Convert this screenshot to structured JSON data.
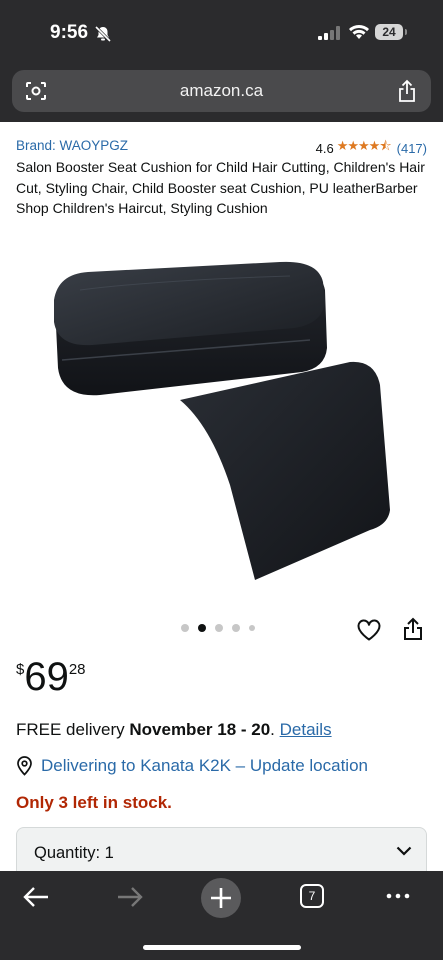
{
  "status_bar": {
    "time": "9:56",
    "battery": "24"
  },
  "browser": {
    "url": "amazon.ca",
    "tab_count": "7"
  },
  "product": {
    "brand": "Brand: WAOYPGZ",
    "rating": "4.6",
    "stars": "★★★★⯪",
    "review_count": "(417)",
    "title": "Salon Booster Seat Cushion for Child Hair Cutting, Children's Hair Cut, Styling Chair, Child Booster seat Cushion, PU leatherBarber Shop Children's Haircut, Styling Cushion",
    "image_count": 5,
    "active_image": 2
  },
  "price": {
    "symbol": "$",
    "whole": "69",
    "fraction": "28"
  },
  "delivery": {
    "prefix": "FREE delivery ",
    "dates": "November 18 - 20",
    "period": ". ",
    "details_link": "Details"
  },
  "location": {
    "text": "Delivering to Kanata K2K – Update location"
  },
  "stock": {
    "text": "Only 3 left in stock."
  },
  "quantity": {
    "label": "Quantity: 1"
  },
  "colors": {
    "link": "#2a6aa8",
    "star": "#de7921",
    "stock": "#b12704",
    "chrome": "#2b2b2d"
  }
}
